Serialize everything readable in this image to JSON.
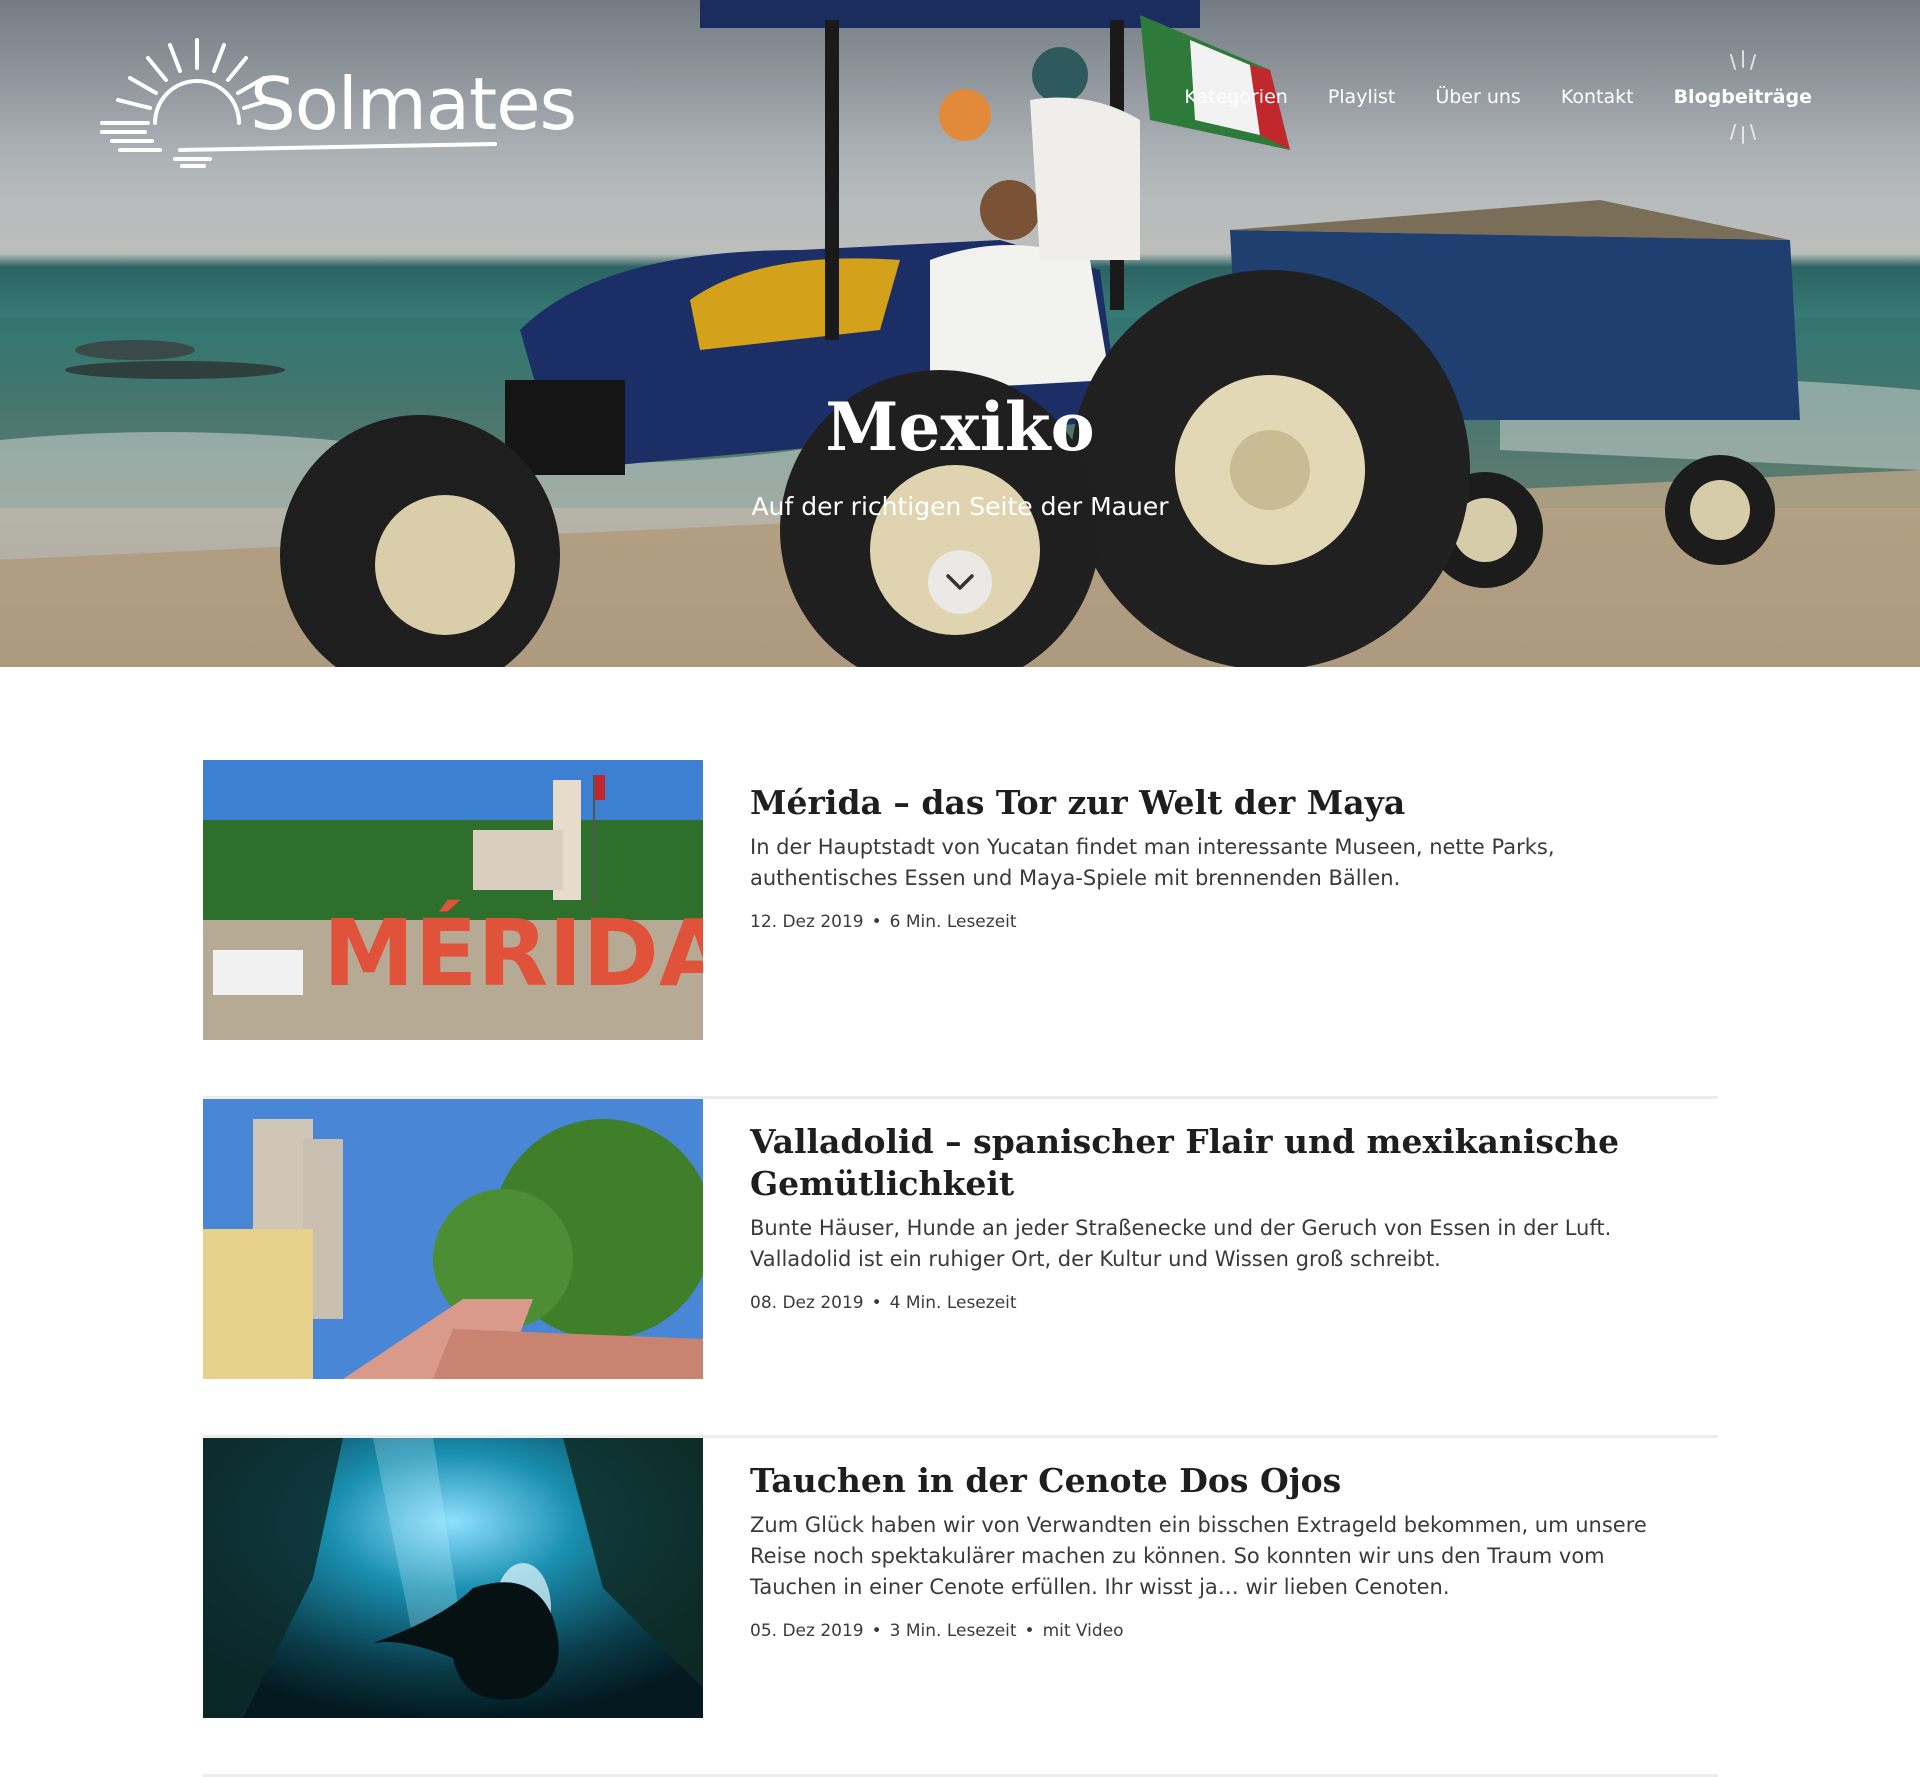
{
  "site": {
    "logo_text": "Solmates"
  },
  "nav": {
    "items": [
      {
        "label": "Kategorien"
      },
      {
        "label": "Playlist"
      },
      {
        "label": "Über uns"
      },
      {
        "label": "Kontakt"
      },
      {
        "label": "Blogbeiträge"
      }
    ]
  },
  "hero": {
    "title": "Mexiko",
    "subtitle": "Auf der richtigen Seite der Mauer"
  },
  "posts": [
    {
      "title": "Mérida – das Tor zur Welt der Maya",
      "excerpt": "In der Hauptstadt von Yucatan findet man interessante Museen, nette Parks, authentisches Essen und Maya-Spiele mit brennenden Bällen.",
      "date": "12. Dez 2019",
      "reading_time": "6 Min. Lesezeit",
      "extra": "",
      "thumb_letters": "MÉRIDA"
    },
    {
      "title": "Valladolid – spanischer Flair und mexikanische Gemütlichkeit",
      "excerpt": "Bunte Häuser, Hunde an jeder Straßenecke und der Geruch von Essen in der Luft. Valladolid ist ein ruhiger Ort, der Kultur und Wissen groß schreibt.",
      "date": "08. Dez 2019",
      "reading_time": "4 Min. Lesezeit",
      "extra": ""
    },
    {
      "title": "Tauchen in der Cenote Dos Ojos",
      "excerpt": "Zum Glück haben wir von Verwandten ein bisschen Extrageld bekommen, um unsere Reise noch spektakulärer machen zu können. So konnten wir uns den Traum vom Tauchen in einer Cenote erfüllen. Ihr wisst ja… wir lieben Cenoten.",
      "date": "05. Dez 2019",
      "reading_time": "3 Min. Lesezeit",
      "extra": "mit Video"
    }
  ]
}
